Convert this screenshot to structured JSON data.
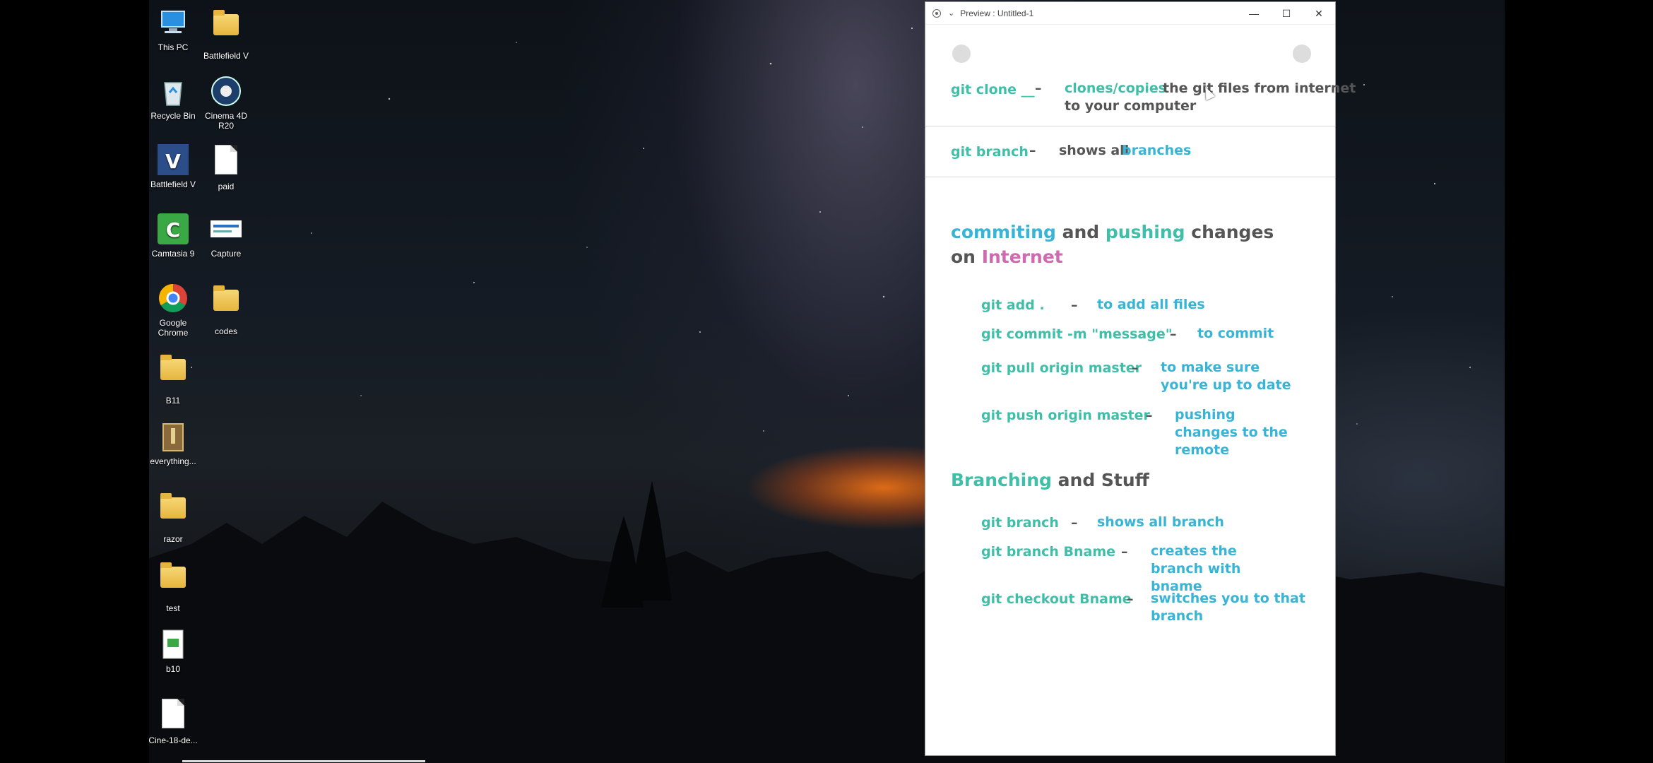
{
  "desktop": {
    "icons": [
      {
        "label": "This PC",
        "icon": "computer-icon"
      },
      {
        "label": "Battlefield V",
        "icon": "folder-icon"
      },
      {
        "label": "Recycle Bin",
        "icon": "recycle-bin-icon"
      },
      {
        "label": "Cinema 4D R20",
        "icon": "cinema4d-icon"
      },
      {
        "label": "Battlefield V",
        "icon": "battlefield-app-icon"
      },
      {
        "label": "paid",
        "icon": "document-icon"
      },
      {
        "label": "Camtasia 9",
        "icon": "camtasia-icon"
      },
      {
        "label": "Capture",
        "icon": "image-icon"
      },
      {
        "label": "Google Chrome",
        "icon": "chrome-icon"
      },
      {
        "label": "codes",
        "icon": "zip-folder-icon"
      },
      {
        "label": "B11",
        "icon": "zip-folder-icon"
      },
      {
        "label": "everything...",
        "icon": "archive-icon"
      },
      {
        "label": "razor",
        "icon": "folder-icon"
      },
      {
        "label": "test",
        "icon": "folder-icon"
      },
      {
        "label": "b10",
        "icon": "file-icon"
      },
      {
        "label": "Cine-18-de...",
        "icon": "document-icon"
      }
    ]
  },
  "window": {
    "title": "Preview : Untitled-1",
    "controls": {
      "minimize": "—",
      "maximize": "☐",
      "close": "✕"
    }
  },
  "doc": {
    "clone": {
      "cmd": "git clone __",
      "dash": "–",
      "desc_a": "clones/copies",
      "desc_b": "the git files from internet",
      "desc_c": "to your computer"
    },
    "branch_top": {
      "cmd": "git branch",
      "dash": "–",
      "desc_a": "shows all",
      "desc_b": "branches"
    },
    "section1": {
      "w1": "commiting",
      "w2": "and",
      "w3": "pushing",
      "w4": "changes",
      "w5": "on",
      "w6": "Internet"
    },
    "items1": [
      {
        "cmd": "git add .",
        "dash": "–",
        "desc": "to add all files"
      },
      {
        "cmd": "git commit -m \"message\"",
        "dash": "–",
        "desc": "to commit"
      },
      {
        "cmd": "git pull origin master",
        "dash": "–",
        "desc": "to make sure you're up to date"
      },
      {
        "cmd": "git push origin master",
        "dash": "–",
        "desc": "pushing changes to the remote"
      }
    ],
    "section2": {
      "w1": "Branching",
      "w2": "and Stuff"
    },
    "items2": [
      {
        "cmd": "git branch",
        "dash": "–",
        "desc": "shows all branch"
      },
      {
        "cmd": "git branch Bname",
        "dash": "–",
        "desc": "creates the branch with bname"
      },
      {
        "cmd": "git checkout Bname",
        "dash": "–",
        "desc": "switches you to that branch"
      }
    ]
  },
  "colors": {
    "teal": "#3fbfa8",
    "blue": "#37b4d6",
    "pink": "#d06ab0",
    "gray": "#555555"
  }
}
